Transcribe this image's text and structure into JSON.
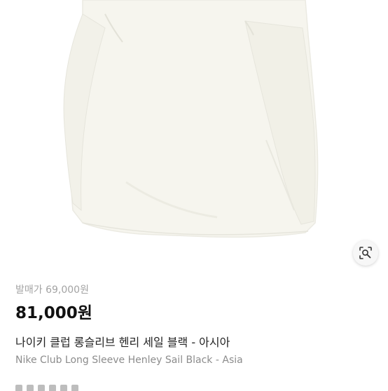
{
  "product": {
    "release_price_label": "발매가",
    "release_price": "69,000원",
    "price": "81,000원",
    "title_ko": "나이키 클럽 롱슬리브 헨리 세일 블랙 - 아시아",
    "title_en": "Nike Club Long Sleeve Henley Sail Black - Asia"
  },
  "icons": {
    "lens": "image-search-icon"
  },
  "colors": {
    "shirt": "#f6f5ee",
    "shirt_shadow": "#e9e8df",
    "release_price_text": "#a3a3a3",
    "price_text": "#111111",
    "subtitle_text": "#8c8c8c"
  }
}
